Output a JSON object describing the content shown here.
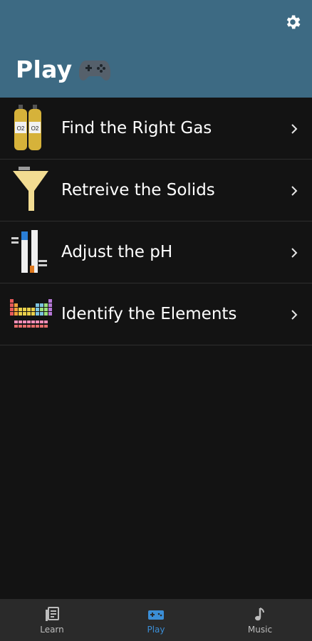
{
  "header": {
    "title": "Play",
    "settings_icon": "gear-icon",
    "title_icon": "gamepad-icon"
  },
  "games": [
    {
      "label": "Find the Right Gas",
      "icon": "gas-cylinders-icon"
    },
    {
      "label": "Retreive the Solids",
      "icon": "funnel-icon"
    },
    {
      "label": "Adjust the pH",
      "icon": "ph-indicator-icon"
    },
    {
      "label": "Identify the Elements",
      "icon": "periodic-table-icon"
    }
  ],
  "bottom_nav": {
    "items": [
      {
        "label": "Learn",
        "icon": "book-icon",
        "active": false
      },
      {
        "label": "Play",
        "icon": "gamepad-icon",
        "active": true
      },
      {
        "label": "Music",
        "icon": "music-note-icon",
        "active": false
      }
    ]
  },
  "colors": {
    "header_bg": "#3d6a83",
    "page_bg": "#131313",
    "nav_bg": "#2a2a2a",
    "accent": "#3b8ed6"
  }
}
